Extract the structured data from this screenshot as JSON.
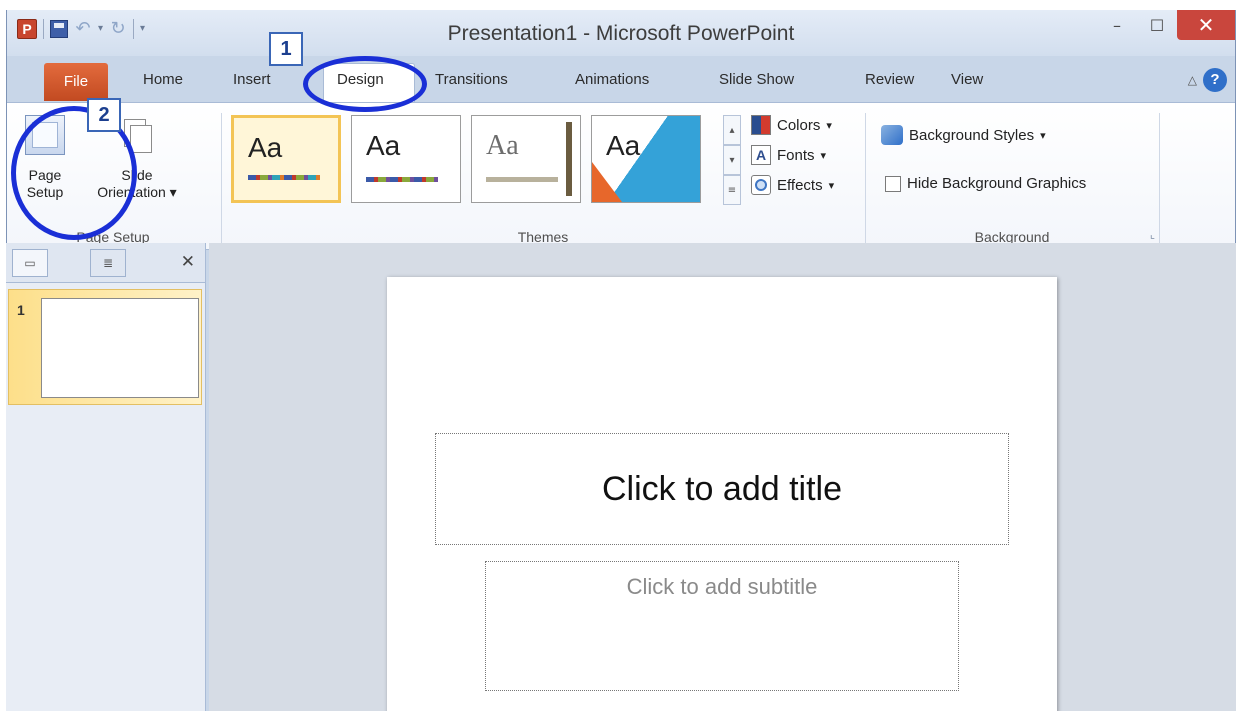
{
  "window": {
    "title": "Presentation1 - Microsoft PowerPoint"
  },
  "qat": {
    "app_letter": "P"
  },
  "window_controls": {
    "minimize": "–",
    "maximize": "☐",
    "close": "✕"
  },
  "tabs": [
    {
      "label": "File"
    },
    {
      "label": "Home"
    },
    {
      "label": "Insert"
    },
    {
      "label": "Design"
    },
    {
      "label": "Transitions"
    },
    {
      "label": "Animations"
    },
    {
      "label": "Slide Show"
    },
    {
      "label": "Review"
    },
    {
      "label": "View"
    }
  ],
  "help": {
    "label": "?"
  },
  "ribbon": {
    "page_setup_group": {
      "label": "Page Setup",
      "page_setup_line1": "Page",
      "page_setup_line2": "Setup",
      "slide_orientation_line1": "Slide",
      "slide_orientation_line2": "Orientation"
    },
    "themes_group": {
      "label": "Themes",
      "theme_aa": "Aa",
      "colors": "Colors",
      "fonts": "Fonts",
      "effects": "Effects",
      "fonts_glyph": "A"
    },
    "background_group": {
      "label": "Background",
      "background_styles": "Background Styles",
      "hide_graphics": "Hide Background Graphics"
    }
  },
  "annotations": {
    "step1": "1",
    "step2": "2"
  },
  "slides_panel": {
    "slide_number": "1"
  },
  "slide": {
    "title_placeholder": "Click to add title",
    "subtitle_placeholder": "Click to add subtitle"
  },
  "colors": {
    "file_tab": "#d2552a",
    "annotation": "#1a2fd6",
    "theme_selected": "#f3c455"
  }
}
